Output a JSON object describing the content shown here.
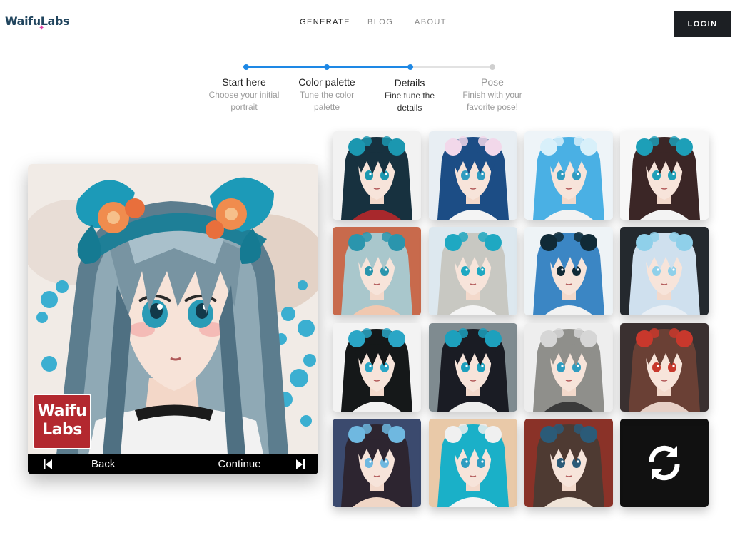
{
  "header": {
    "logo_text": "WaifuLabs",
    "nav": [
      {
        "label": "GENERATE",
        "active": true
      },
      {
        "label": "BLOG",
        "active": false
      },
      {
        "label": "ABOUT",
        "active": false
      }
    ],
    "login_label": "LOGIN"
  },
  "stepper": {
    "accent_color": "#1e88e5",
    "inactive_color": "#cfcfcf",
    "steps": [
      {
        "title": "Start here",
        "desc_line1": "Choose your initial",
        "desc_line2": "portrait",
        "state": "done"
      },
      {
        "title": "Color palette",
        "desc_line1": "Tune the color",
        "desc_line2": "palette",
        "state": "done"
      },
      {
        "title": "Details",
        "desc_line1": "Fine tune the",
        "desc_line2": "details",
        "state": "active"
      },
      {
        "title": "Pose",
        "desc_line1": "Finish with your",
        "desc_line2": "favorite pose!",
        "state": "future"
      }
    ]
  },
  "preview": {
    "watermark_line1": "Waifu",
    "watermark_line2": "Labs",
    "back_label": "Back",
    "continue_label": "Continue"
  },
  "grid": {
    "tiles": [
      {
        "bg": "#f2f2f2",
        "hair": "#17313f",
        "accent": "#1b97b0",
        "collar": "#a8282c"
      },
      {
        "bg": "#e8eef3",
        "hair": "#1c4d85",
        "accent": "#f2d8ea",
        "collar": "#f4f4f4"
      },
      {
        "bg": "#eef4f8",
        "hair": "#4ab0e4",
        "accent": "#d8f0fa",
        "collar": "#f2f2f2"
      },
      {
        "bg": "#f7f7f7",
        "hair": "#3b2626",
        "accent": "#1d9fb8",
        "collar": "#f3f3f3"
      },
      {
        "bg": "#c86a4c",
        "hair": "#a9c7cc",
        "accent": "#2a95ad",
        "collar": "#f0c8b0"
      },
      {
        "bg": "#dde8ef",
        "hair": "#c8c8c2",
        "accent": "#1ea8c2",
        "collar": "#f4f4f4"
      },
      {
        "bg": "#eef3f6",
        "hair": "#3b86c4",
        "accent": "#102a36",
        "collar": "#f2f2f2"
      },
      {
        "bg": "#24292e",
        "hair": "#cfe0ee",
        "accent": "#8fd0ea",
        "collar": "#e8eef4"
      },
      {
        "bg": "#f3f3f3",
        "hair": "#151819",
        "accent": "#2aa6c6",
        "collar": "#f2f2f2"
      },
      {
        "bg": "#7f8b90",
        "hair": "#1a1c24",
        "accent": "#1da0bd",
        "collar": "#eeeeee"
      },
      {
        "bg": "#eeeeee",
        "hair": "#8f8f8b",
        "accent": "#d6d6d6",
        "collar": "#3a3a3a"
      },
      {
        "bg": "#3a3030",
        "hair": "#6a4035",
        "accent": "#c8382c",
        "collar": "#e6d0c6"
      },
      {
        "bg": "#3b4a6e",
        "hair": "#2d2530",
        "accent": "#6fb8e0",
        "collar": "#f0d6c6"
      },
      {
        "bg": "#e9c9a8",
        "hair": "#1ab0c8",
        "accent": "#f0f0f0",
        "collar": "#f4f4f4"
      },
      {
        "bg": "#8a3228",
        "hair": "#4e3a32",
        "accent": "#2b5b78",
        "collar": "#f0e4d8"
      }
    ],
    "refresh_icon": "refresh-icon"
  }
}
